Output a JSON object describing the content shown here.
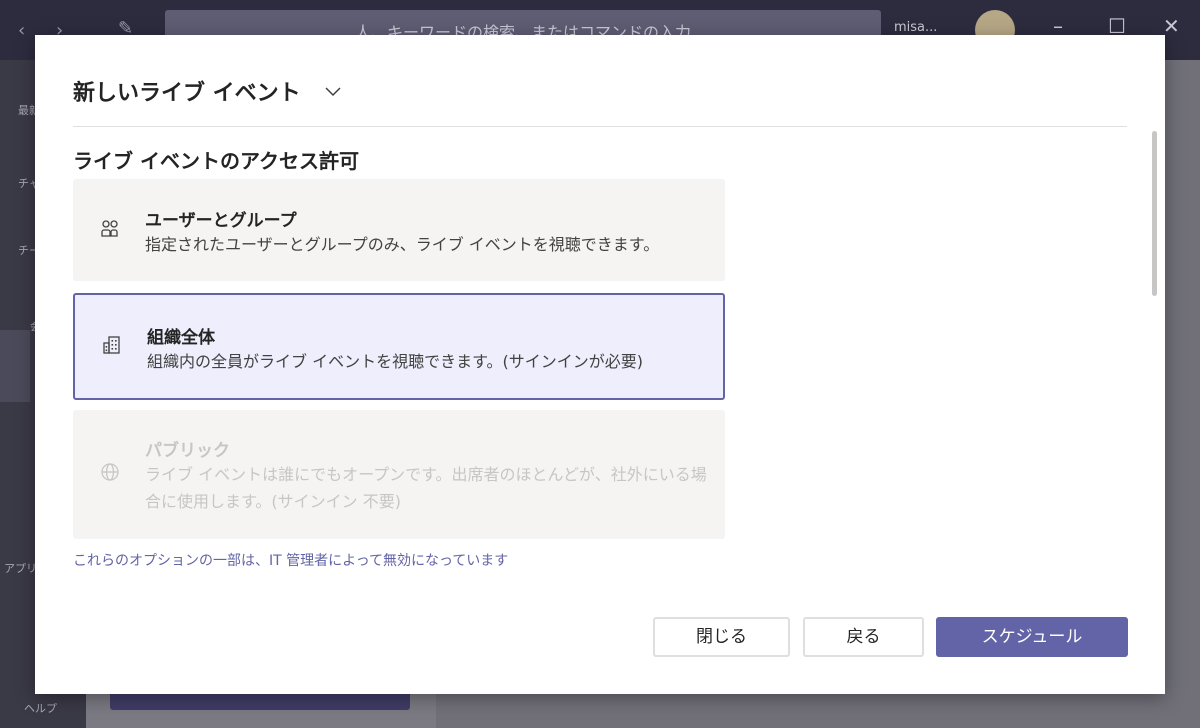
{
  "background": {
    "search_placeholder": "人、キーワードの検索、またはコマンドの入力",
    "account": "misa...",
    "rail": {
      "recent": "最新",
      "chat": "チャ",
      "teams": "チー",
      "calendar": "会",
      "apps": "アプリ",
      "help": "ヘルプ"
    }
  },
  "dialog": {
    "title": "新しいライブ イベント",
    "section_title": "ライブ イベントのアクセス許可",
    "options": [
      {
        "icon": "people-icon",
        "title": "ユーザーとグループ",
        "description": "指定されたユーザーとグループのみ、ライブ イベントを視聴できます。",
        "state": "enabled"
      },
      {
        "icon": "building-icon",
        "title": "組織全体",
        "description": "組織内の全員がライブ イベントを視聴できます。(サインインが必要)",
        "state": "selected"
      },
      {
        "icon": "globe-icon",
        "title": "パブリック",
        "description": "ライブ イベントは誰にでもオープンです。出席者のほとんどが、社外にいる場合に使用します。(サインイン 不要)",
        "state": "disabled"
      }
    ],
    "note": "これらのオプションの一部は、IT 管理者によって無効になっています",
    "buttons": {
      "close": "閉じる",
      "back": "戻る",
      "schedule": "スケジュール"
    }
  },
  "colors": {
    "accent": "#6264a7",
    "selected_bg": "#eeeefc",
    "option_bg": "#f5f4f3",
    "disabled_text": "#c8c6c4"
  }
}
